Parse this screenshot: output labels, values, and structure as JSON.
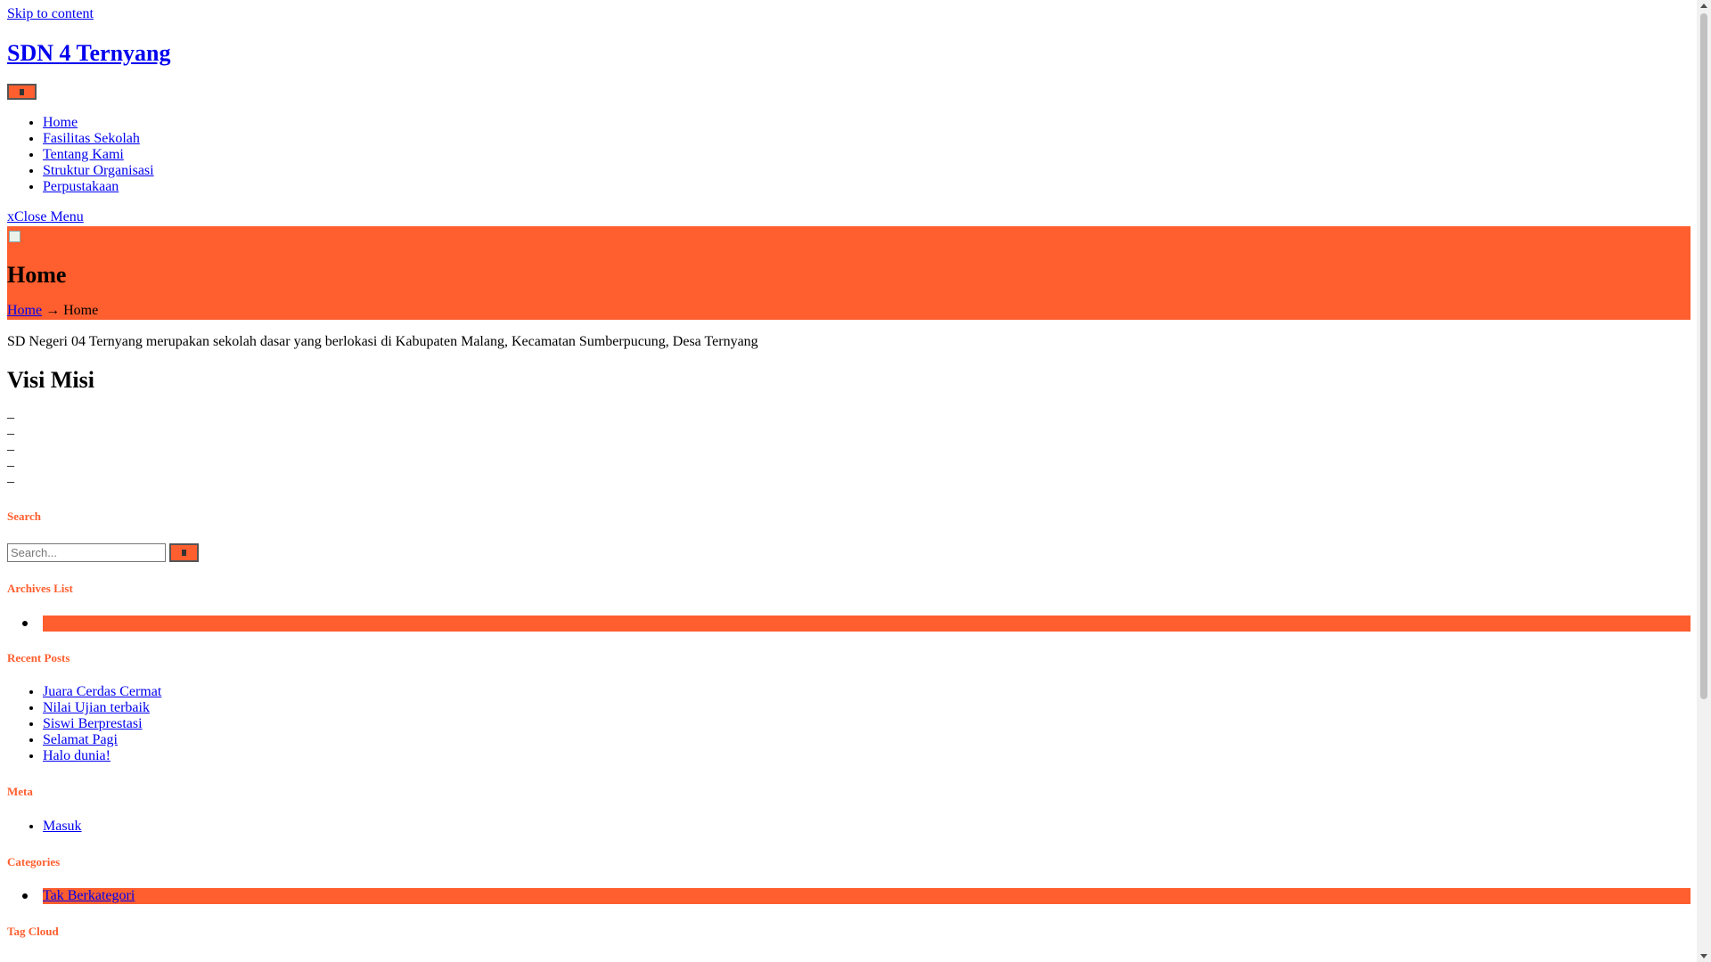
{
  "skip_link": "Skip to content",
  "site_title": "SDN 4 Ternyang",
  "menu_toggle_icon": "hamburger-icon",
  "nav": {
    "items": [
      {
        "label": "Home"
      },
      {
        "label": "Fasilitas Sekolah"
      },
      {
        "label": "Tentang Kami"
      },
      {
        "label": "Struktur Organisasi"
      },
      {
        "label": "Perpustakaan"
      }
    ],
    "close_prefix": "x",
    "close_label": "Close Menu"
  },
  "hero": {
    "title": "Home",
    "breadcrumb": {
      "home": "Home",
      "separator": "→",
      "current": "Home"
    },
    "background_color": "#ff5e2e"
  },
  "intro_text": "SD Negeri 04 Ternyang merupakan sekolah dasar yang berlokasi di Kabupaten Malang, Kecamatan Sumberpucung, Desa Ternyang",
  "visi_misi": {
    "heading": "Visi Misi",
    "lines": [
      "_",
      "_",
      "_",
      "_",
      "_"
    ]
  },
  "widgets": {
    "search": {
      "title": "Search",
      "placeholder": "Search...",
      "button_icon": "search-icon"
    },
    "archives": {
      "title": "Archives List"
    },
    "recent_posts": {
      "title": "Recent Posts",
      "items": [
        "Juara Cerdas Cermat",
        "Nilai Ujian terbaik",
        "Siswi Berprestasi",
        "Selamat Pagi",
        "Halo dunia!"
      ]
    },
    "meta": {
      "title": "Meta",
      "items": [
        "Masuk"
      ]
    },
    "categories": {
      "title": "Categories",
      "items": [
        "Tak Berkategori"
      ]
    },
    "tag_cloud": {
      "title": "Tag Cloud"
    }
  },
  "colors": {
    "accent": "#ff5e2e",
    "link": "#0000ee"
  }
}
